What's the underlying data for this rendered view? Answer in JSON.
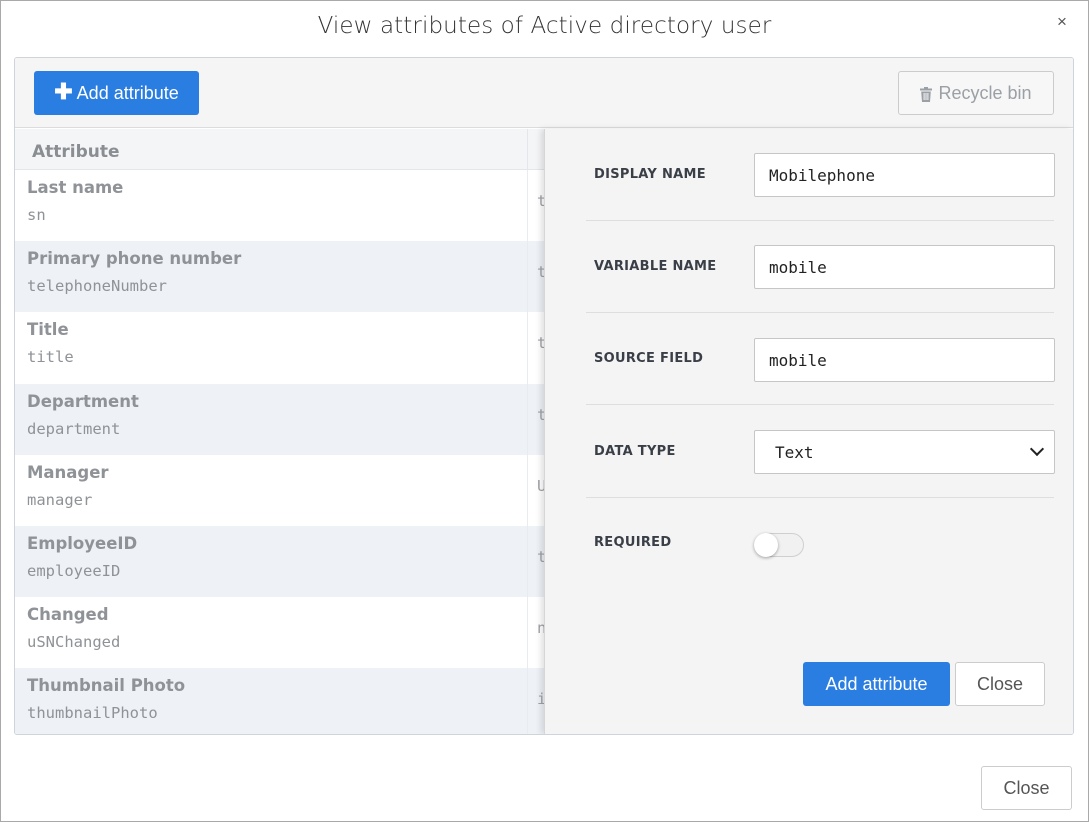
{
  "modal": {
    "title": "View attributes of Active directory user",
    "close_glyph": "×",
    "footer_close_label": "Close"
  },
  "toolbar": {
    "add_label": "Add attribute",
    "add_icon": "plus-icon",
    "recycle_label": "Recycle bin",
    "recycle_icon": "trash-icon"
  },
  "table": {
    "header": "Attribute",
    "rows": [
      {
        "label": "Last name",
        "variable": "sn",
        "type": "t"
      },
      {
        "label": "Primary phone number",
        "variable": "telephoneNumber",
        "type": "t"
      },
      {
        "label": "Title",
        "variable": "title",
        "type": "t"
      },
      {
        "label": "Department",
        "variable": "department",
        "type": "t"
      },
      {
        "label": "Manager",
        "variable": "manager",
        "type": "U"
      },
      {
        "label": "EmployeeID",
        "variable": "employeeID",
        "type": "t"
      },
      {
        "label": "Changed",
        "variable": "uSNChanged",
        "type": "n"
      },
      {
        "label": "Thumbnail Photo",
        "variable": "thumbnailPhoto",
        "type": "i"
      }
    ]
  },
  "form": {
    "display_name_label": "DISPLAY NAME",
    "display_name_value": "Mobilephone",
    "variable_name_label": "VARIABLE NAME",
    "variable_name_value": "mobile",
    "source_field_label": "SOURCE FIELD",
    "source_field_value": "mobile",
    "data_type_label": "DATA TYPE",
    "data_type_value": "Text",
    "required_label": "REQUIRED",
    "required_on": false,
    "submit_label": "Add attribute",
    "close_label": "Close"
  },
  "colors": {
    "primary": "#2a7de1",
    "row_alt": "#eef2f7",
    "side_bg": "#f4f4f4"
  }
}
